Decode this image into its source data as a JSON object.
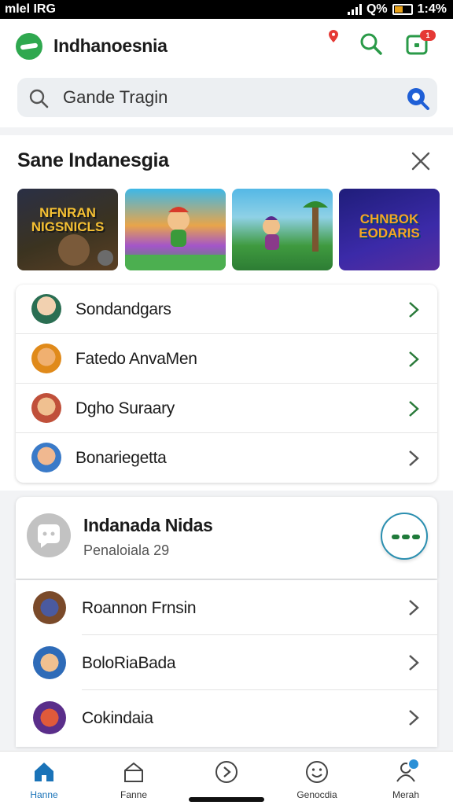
{
  "status_bar": {
    "carrier": "mlel IRG",
    "battery_text": "Q%",
    "time": "1:4%"
  },
  "header": {
    "app_title": "Indhanoesnia",
    "inbox_badge": "1"
  },
  "search": {
    "placeholder": "Gande Tragin"
  },
  "featured": {
    "title": "Sane Indanesgia",
    "thumbnails": [
      {
        "text": "NFNRAN NIGSNICLS"
      },
      {
        "text": ""
      },
      {
        "text": ""
      },
      {
        "text": "CHNBOK EODARIS"
      }
    ],
    "items": [
      {
        "label": "Sondandgars"
      },
      {
        "label": "Fatedo AnvaMen"
      },
      {
        "label": "Dgho Suraary"
      },
      {
        "label": "Bonariegetta"
      }
    ]
  },
  "group": {
    "title": "Indanada Nidas",
    "subtitle": "Penaloiala 29",
    "items": [
      {
        "label": "Roannon Frnsin"
      },
      {
        "label": "BoloRiaBada"
      },
      {
        "label": "Cokindaia"
      }
    ]
  },
  "bottom_nav": {
    "items": [
      {
        "label": "Hanne",
        "icon": "home-icon",
        "active": true
      },
      {
        "label": "Fanne",
        "icon": "box-icon",
        "active": false
      },
      {
        "label": "",
        "icon": "play-circle-icon",
        "active": false
      },
      {
        "label": "Genocdia",
        "icon": "smile-icon",
        "active": false
      },
      {
        "label": "Merah",
        "icon": "user-icon",
        "active": false
      }
    ]
  },
  "colors": {
    "accent": "#2fa84f",
    "nav_active": "#1a73b8",
    "badge": "#e53935"
  }
}
